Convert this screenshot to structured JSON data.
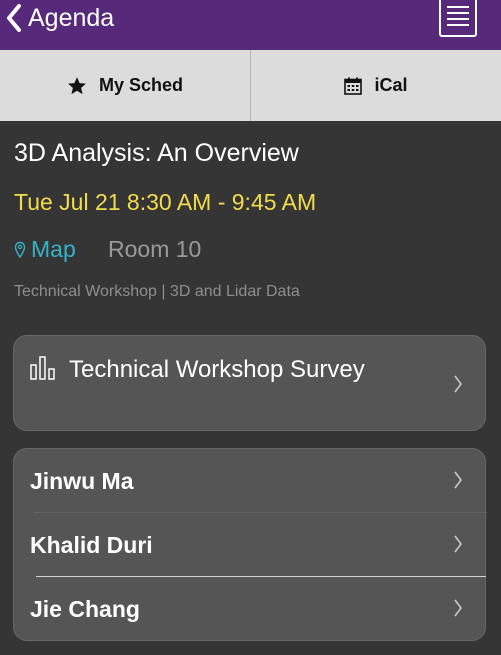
{
  "nav": {
    "back_label": "Agenda",
    "back_icon": "chevron-left-icon",
    "notes_icon": "notes-icon"
  },
  "toolbar": {
    "my_sched_label": "My Sched",
    "my_sched_icon": "star-icon",
    "ical_label": "iCal",
    "ical_icon": "calendar-icon"
  },
  "session": {
    "title": "3D Analysis: An Overview",
    "time": "Tue Jul 21 8:30 AM - 9:45 AM",
    "map_label": "Map",
    "room": "Room 10",
    "track": "Technical Workshop | 3D and Lidar Data"
  },
  "survey": {
    "label": "Technical Workshop Survey",
    "icon": "bar-chart-icon"
  },
  "speakers": [
    {
      "name": "Jinwu Ma"
    },
    {
      "name": "Khalid Duri"
    },
    {
      "name": "Jie Chang"
    }
  ],
  "colors": {
    "nav_bg": "#56297a",
    "toolbar_bg": "#dcdcdc",
    "page_bg": "#353535",
    "card_bg": "#555555",
    "time_text": "#f3dc4a",
    "map_link": "#33b3c9",
    "room_text": "#9a9a9a"
  }
}
